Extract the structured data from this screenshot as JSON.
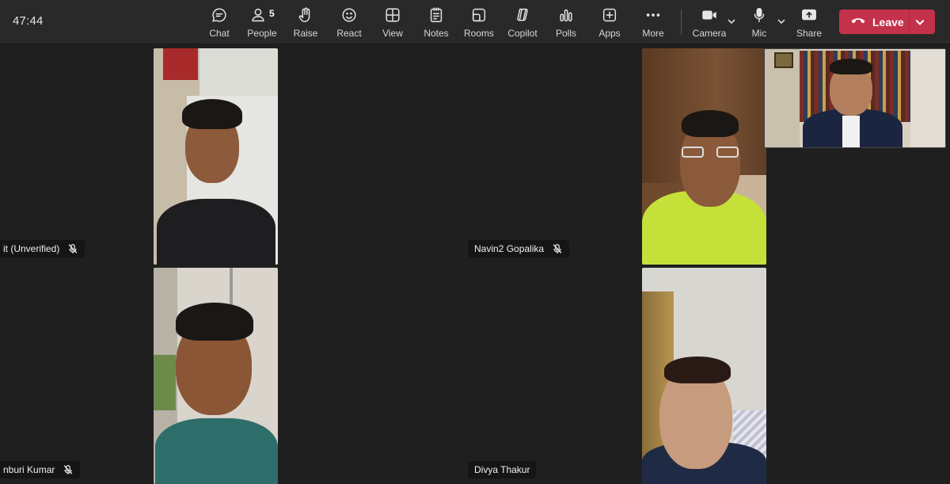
{
  "meeting": {
    "timer": "47:44"
  },
  "toolbar": {
    "chat": {
      "label": "Chat",
      "icon": "chat-icon"
    },
    "people": {
      "label": "People",
      "icon": "people-icon",
      "count": "5"
    },
    "raise": {
      "label": "Raise",
      "icon": "raise-hand-icon"
    },
    "react": {
      "label": "React",
      "icon": "smiley-icon"
    },
    "view": {
      "label": "View",
      "icon": "grid-view-icon"
    },
    "notes": {
      "label": "Notes",
      "icon": "notes-icon"
    },
    "rooms": {
      "label": "Rooms",
      "icon": "rooms-icon"
    },
    "copilot": {
      "label": "Copilot",
      "icon": "copilot-icon"
    },
    "polls": {
      "label": "Polls",
      "icon": "polls-icon"
    },
    "apps": {
      "label": "Apps",
      "icon": "add-app-icon"
    },
    "more": {
      "label": "More",
      "icon": "ellipsis-icon"
    },
    "camera": {
      "label": "Camera",
      "icon": "camera-icon"
    },
    "mic": {
      "label": "Mic",
      "icon": "microphone-icon"
    },
    "share": {
      "label": "Share",
      "icon": "share-screen-icon"
    },
    "leave": {
      "label": "Leave",
      "icon": "hang-up-icon",
      "color": "#c4314b"
    }
  },
  "participants": [
    {
      "name": "it (Unverified)",
      "muted": true
    },
    {
      "name": "Navin2 Gopalika",
      "muted": true
    },
    {
      "name": "nburi Kumar",
      "muted": true
    },
    {
      "name": "Divya Thakur",
      "muted": false
    }
  ],
  "colors": {
    "toolbar_bg": "#292929",
    "stage_bg": "#1f1f1f",
    "leave_red": "#c4314b"
  }
}
